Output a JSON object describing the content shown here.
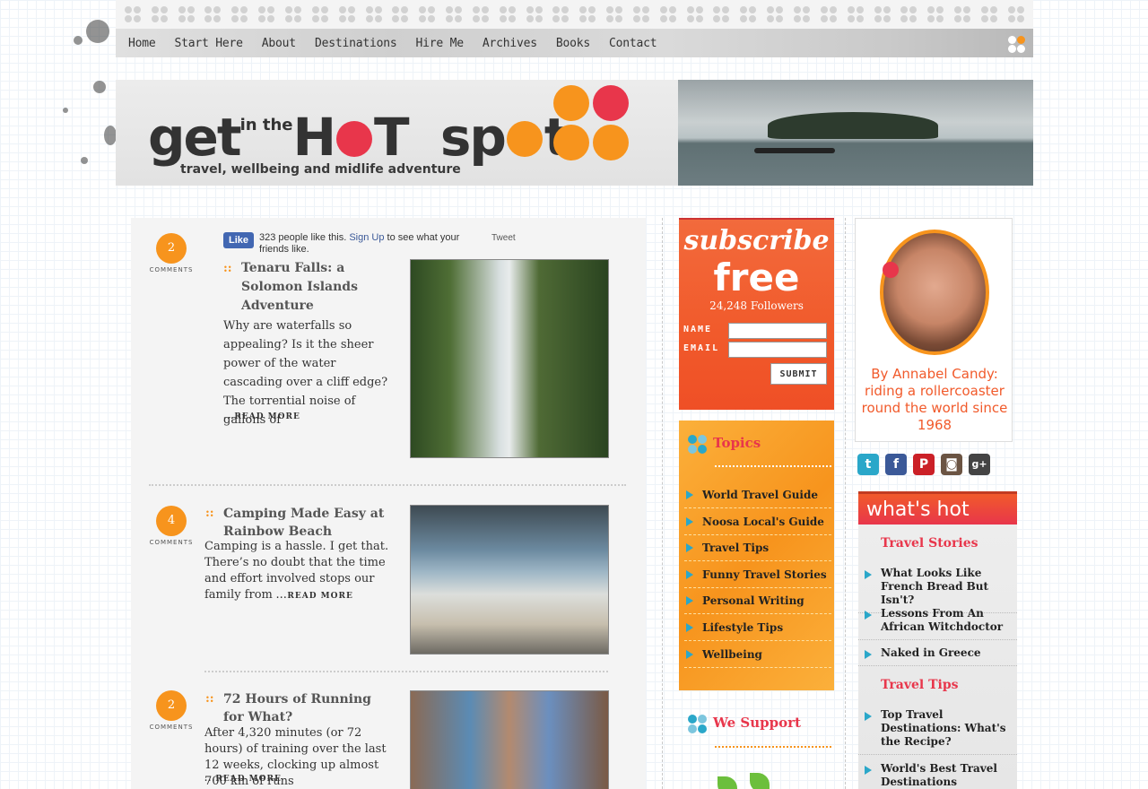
{
  "nav": {
    "items": [
      "Home",
      "Start Here",
      "About",
      "Destinations",
      "Hire Me",
      "Archives",
      "Books",
      "Contact"
    ]
  },
  "header": {
    "logo_word_1": "get",
    "logo_small": "in the",
    "logo_word_2a": "H",
    "logo_word_2b": "T",
    "logo_word_3a": "sp",
    "logo_word_3b": "t",
    "tagline": "travel, wellbeing and midlife adventure"
  },
  "facebook": {
    "like_label": "Like",
    "count_text": "323 people like this.",
    "signup_link": "Sign Up",
    "rest_text": "to see what your friends like."
  },
  "tweet_label": "Tweet",
  "posts": [
    {
      "comments": "2",
      "comments_label": "COMMENTS",
      "marker": "::",
      "title": "Tenaru Falls: a Solomon Islands Adventure",
      "excerpt": "Why are waterfalls so appealing? Is it the sheer power of the water cascading over a cliff edge? The torrential noise of gallons of",
      "read_more": "...READ MORE"
    },
    {
      "comments": "4",
      "comments_label": "COMMENTS",
      "marker": "::",
      "title": "Camping Made Easy at Rainbow Beach",
      "excerpt": "Camping is a hassle. I get that. There’s no doubt that the time and effort involved stops our family from",
      "read_more": "...READ MORE"
    },
    {
      "comments": "2",
      "comments_label": "COMMENTS",
      "marker": "::",
      "title": "72 Hours of Running for What?",
      "excerpt": "After 4,320 minutes (or 72 hours) of training over the last 12 weeks, clocking up almost 700 km of runs",
      "read_more": "...READ MORE"
    }
  ],
  "subscribe": {
    "heading": "subscribe",
    "free": "free",
    "followers": "24,248 Followers",
    "name_label": "NAME",
    "email_label": "EMAIL",
    "name_value": "",
    "email_value": "",
    "submit": "SUBMIT"
  },
  "topics": {
    "title": "Topics",
    "items": [
      "World Travel Guide",
      "Noosa Local's Guide",
      "Travel Tips",
      "Funny Travel Stories",
      "Personal Writing",
      "Lifestyle Tips",
      "Wellbeing"
    ]
  },
  "support": {
    "title": "We Support"
  },
  "author": {
    "caption": "By Annabel Candy: riding a rollercoaster round the world since 1968"
  },
  "social": [
    "t",
    "f",
    "P",
    "◙",
    "g+"
  ],
  "whatshot": {
    "banner": "what's hot",
    "section_1": "Travel Stories",
    "stories": [
      "What Looks Like French Bread But Isn't?",
      "Lessons From An African Witchdoctor",
      "Naked in Greece"
    ],
    "section_2": "Travel Tips",
    "tips": [
      "Top Travel Destinations: What's the Recipe?",
      "World's Best Travel Destinations"
    ]
  },
  "colors": {
    "orange": "#f7941d",
    "red": "#e8364b",
    "blue_arrow": "#2aa7c9"
  }
}
